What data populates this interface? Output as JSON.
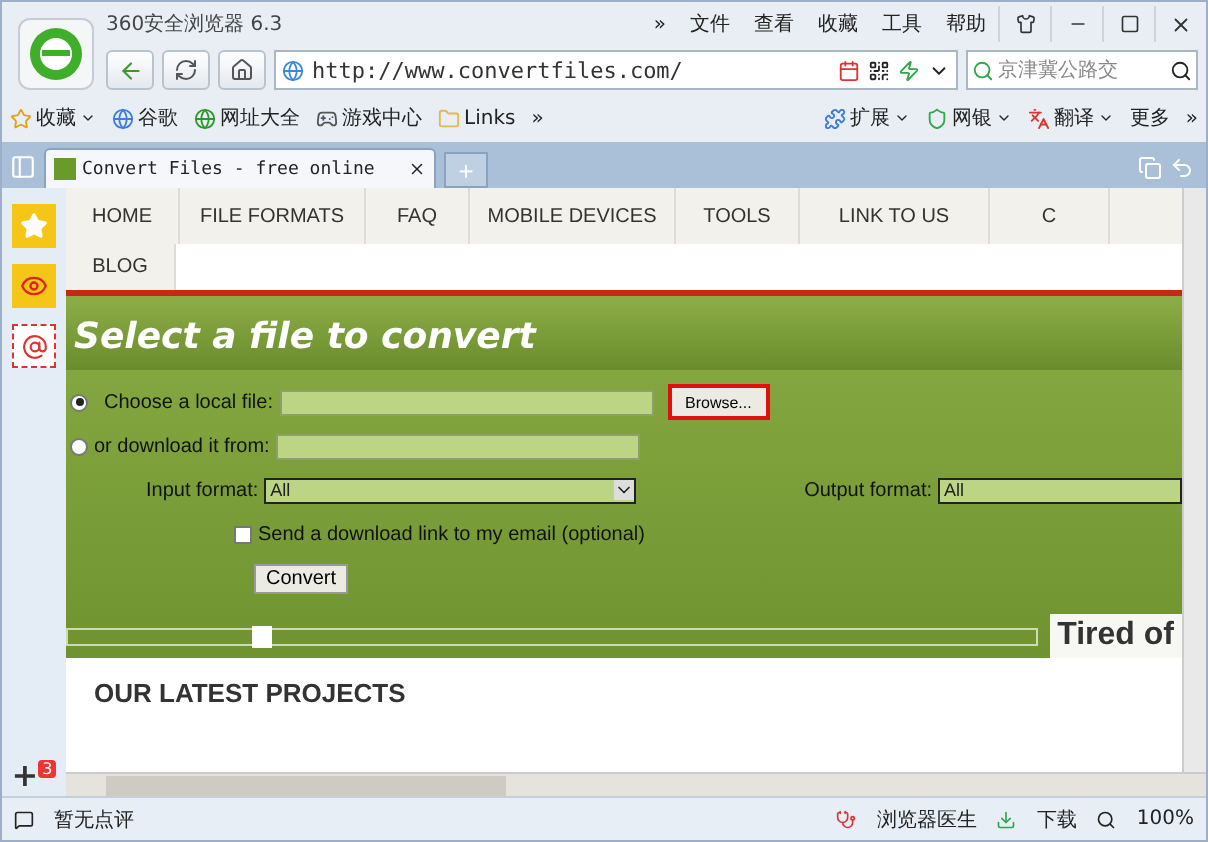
{
  "window": {
    "title": "360安全浏览器 6.3",
    "menu": [
      "»",
      "文件",
      "查看",
      "收藏",
      "工具",
      "帮助"
    ]
  },
  "toolbar": {
    "address": "http://www.convertfiles.com/",
    "search_placeholder": "京津冀公路交"
  },
  "bookmarks": {
    "left": [
      {
        "label": "收藏",
        "dropdown": true
      },
      {
        "label": "谷歌",
        "dropdown": false
      },
      {
        "label": "网址大全",
        "dropdown": false
      },
      {
        "label": "游戏中心",
        "dropdown": false
      },
      {
        "label": "Links",
        "dropdown": false
      }
    ],
    "left_more": "»",
    "right": [
      {
        "label": "扩展",
        "dropdown": true
      },
      {
        "label": "网银",
        "dropdown": true
      },
      {
        "label": "翻译",
        "dropdown": true
      },
      {
        "label": "更多",
        "dropdown": false
      }
    ],
    "right_more": "»"
  },
  "tabs": [
    {
      "title": "Convert Files - free online",
      "selected": true
    }
  ],
  "new_tab": "+",
  "sidebar": {
    "add": "+",
    "badge": "3"
  },
  "page": {
    "nav": [
      {
        "label": "HOME"
      },
      {
        "label": "FILE FORMATS"
      },
      {
        "label": "FAQ"
      },
      {
        "label": "MOBILE DEVICES"
      },
      {
        "label": "TOOLS"
      },
      {
        "label": "LINK TO US"
      },
      {
        "label": "C"
      }
    ],
    "nav_row2": [
      {
        "label": "BLOG"
      }
    ],
    "heading": "Select a file to convert",
    "sources": [
      {
        "label": "Choose a local file:",
        "selected": true,
        "browse": "Browse..."
      },
      {
        "label": "or download it from:",
        "selected": false
      }
    ],
    "input_format": {
      "label": "Input format:",
      "value": "All"
    },
    "output_format": {
      "label": "Output format:",
      "value": "All"
    },
    "email": {
      "label": "Send a download link to my email (optional)",
      "checked": false
    },
    "convert": "Convert",
    "slider": {
      "level": 0.19
    },
    "promo": "Tired of",
    "section": "OUR LATEST PROJECTS"
  },
  "status_bar": {
    "review": "暂无点评",
    "doctor": "浏览器医生",
    "download": "下载",
    "zoom": "100%"
  }
}
